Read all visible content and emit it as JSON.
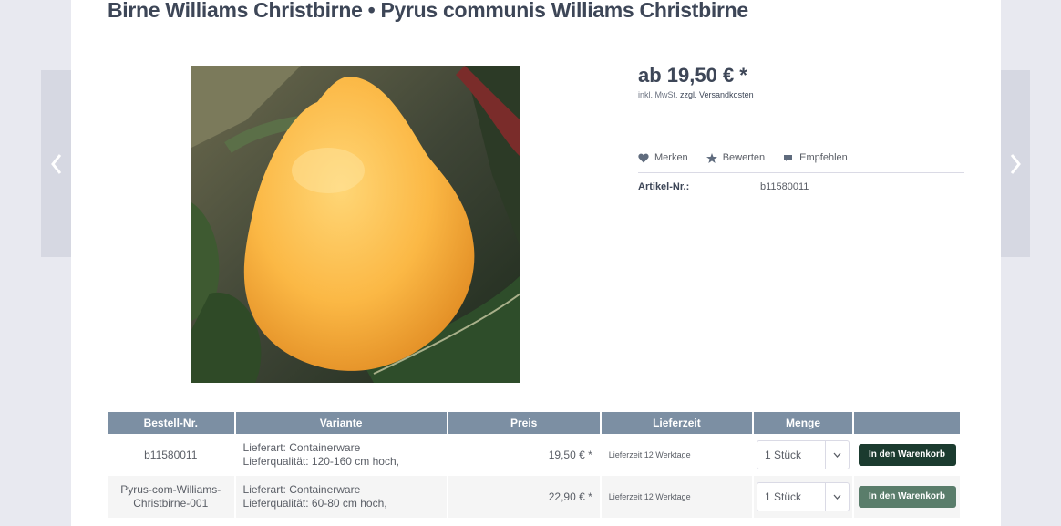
{
  "product": {
    "title": "Birne Williams Christbirne • Pyrus communis Williams Christbirne",
    "image_alt": "Birne Williams Christbirne",
    "price": "ab 19,50 € *",
    "tax_note": "inkl. MwSt.",
    "shipping_link": "zzgl. Versandkosten",
    "sku_label": "Artikel-Nr.:",
    "sku_value": "b11580011"
  },
  "actions": [
    {
      "label": "Merken",
      "icon": "heart-icon"
    },
    {
      "label": "Bewerten",
      "icon": "star-icon"
    },
    {
      "label": "Empfehlen",
      "icon": "comment-icon"
    }
  ],
  "nav": {
    "prev_icon": "chevron-left-icon",
    "next_icon": "chevron-right-icon"
  },
  "table": {
    "headers": [
      "Bestell-Nr.",
      "Variante",
      "Preis",
      "Lieferzeit",
      "Menge",
      ""
    ],
    "rows": [
      {
        "sku": "b11580011",
        "variant_line1": "Lieferart: Containerware",
        "variant_line2": "Lieferqualität: 120-160 cm hoch,",
        "price": "19,50 € *",
        "delivery": "Lieferzeit 12 Werktage",
        "qty": "1 Stück",
        "button": "In den Warenkorb"
      },
      {
        "sku": "Pyrus-com-Williams-Christbirne-001",
        "sku_line1": "Pyrus-com-Williams-",
        "sku_line2": "Christbirne-001",
        "variant_line1": "Lieferart: Containerware",
        "variant_line2": "Lieferqualität: 60-80 cm hoch,",
        "price": "22,90 € *",
        "delivery": "Lieferzeit 12 Werktage",
        "qty": "1 Stück",
        "button": "In den Warenkorb"
      }
    ]
  },
  "colors": {
    "header_bg": "#7c8fa3",
    "button_dark": "#1b3b2f",
    "button_light": "#5a7d6b",
    "title": "#3d4657"
  }
}
